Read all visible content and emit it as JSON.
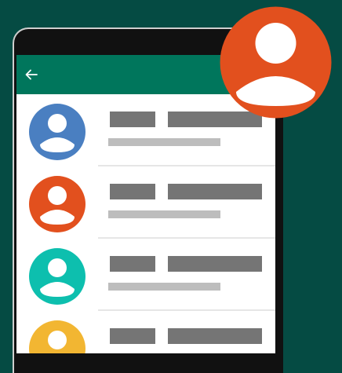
{
  "colors": {
    "background": "#054b43",
    "appbar": "#00765c",
    "screen": "#ffffff",
    "placeholder_dark": "#757575",
    "placeholder_light": "#bdbdbd",
    "divider": "#e6e6e6"
  },
  "appbar": {
    "back_icon": "arrow-left-icon"
  },
  "contacts": [
    {
      "avatar_icon": "person-icon",
      "avatar_color": "#4a7fc1"
    },
    {
      "avatar_icon": "person-icon",
      "avatar_color": "#e2501e"
    },
    {
      "avatar_icon": "person-icon",
      "avatar_color": "#0dbfae"
    },
    {
      "avatar_icon": "person-icon",
      "avatar_color": "#f2b632"
    }
  ],
  "profile_badge": {
    "avatar_icon": "person-icon",
    "avatar_color": "#e2501e"
  }
}
